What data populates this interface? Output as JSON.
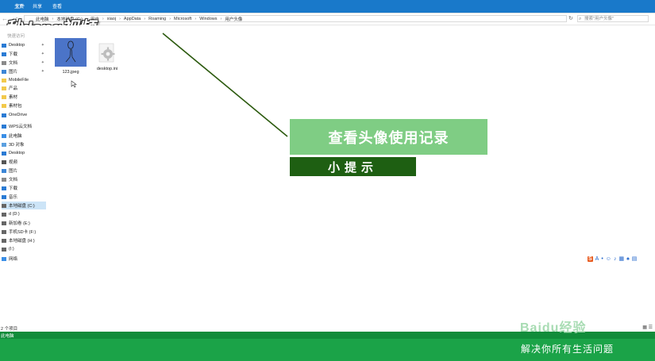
{
  "ribbon": {
    "file_tab": "文件",
    "tabs": [
      "主页",
      "共享",
      "查看"
    ]
  },
  "nav": {
    "back": "←",
    "forward": "→",
    "up": "↑"
  },
  "address": {
    "crumbs": [
      "此电脑",
      "本地磁盘 (C:)",
      "用户",
      "xiaoj",
      "AppData",
      "Roaming",
      "Microsoft",
      "Windows",
      "用户头像"
    ],
    "separator": "›"
  },
  "search": {
    "placeholder": "搜索\"用户头像\""
  },
  "watermark": {
    "logo_text": "秒dong视频"
  },
  "sidebar": {
    "quick_access": "快速访问",
    "items": [
      {
        "label": "Desktop",
        "icon": "desktop-icon",
        "pinned": true
      },
      {
        "label": "下载",
        "icon": "download-icon",
        "pinned": true
      },
      {
        "label": "文档",
        "icon": "document-icon",
        "pinned": true
      },
      {
        "label": "图片",
        "icon": "picture-icon",
        "pinned": true
      },
      {
        "label": "MobileFile",
        "icon": "folder-icon",
        "pinned": false
      },
      {
        "label": "产品",
        "icon": "folder-icon",
        "pinned": false
      },
      {
        "label": "素材",
        "icon": "folder-icon",
        "pinned": false
      },
      {
        "label": "素材包",
        "icon": "folder-icon",
        "pinned": false
      },
      {
        "label": "OneDrive",
        "icon": "cloud-icon",
        "pinned": false
      },
      {
        "label": "WPS云文档",
        "icon": "cloud-icon",
        "pinned": false
      },
      {
        "label": "此电脑",
        "icon": "computer-icon",
        "pinned": false
      },
      {
        "label": "3D 对象",
        "icon": "cube-icon",
        "pinned": false
      },
      {
        "label": "Desktop",
        "icon": "desktop-icon",
        "pinned": false
      },
      {
        "label": "视频",
        "icon": "video-icon",
        "pinned": false
      },
      {
        "label": "图片",
        "icon": "picture-icon",
        "pinned": false
      },
      {
        "label": "文档",
        "icon": "document-icon",
        "pinned": false
      },
      {
        "label": "下载",
        "icon": "download-icon",
        "pinned": false
      },
      {
        "label": "音乐",
        "icon": "music-icon",
        "pinned": false
      },
      {
        "label": "本地磁盘 (C:)",
        "icon": "drive-icon",
        "pinned": false,
        "selected": true
      },
      {
        "label": "d (D:)",
        "icon": "drive-icon",
        "pinned": false
      },
      {
        "label": "新加卷 (E:)",
        "icon": "drive-icon",
        "pinned": false
      },
      {
        "label": "手机SD卡 (F:)",
        "icon": "drive-icon",
        "pinned": false
      },
      {
        "label": "本地磁盘 (H:)",
        "icon": "drive-icon",
        "pinned": false
      },
      {
        "label": "(I:)",
        "icon": "drive-icon",
        "pinned": false
      },
      {
        "label": "网络",
        "icon": "network-icon",
        "pinned": false
      }
    ]
  },
  "files": [
    {
      "name": "123.jpeg",
      "type": "image"
    },
    {
      "name": "desktop.ini",
      "type": "settings"
    }
  ],
  "overlay": {
    "title": "查看头像使用记录",
    "tip": "小提示"
  },
  "status": {
    "count": "2 个项目"
  },
  "taskbar": {
    "label": "此电脑"
  },
  "footer": {
    "brand": "Baidu经验",
    "slogan": "解决你所有生活问题"
  },
  "ime": {
    "logo": "S",
    "lang": "A",
    "icons": [
      "dot",
      "smile",
      "mic",
      "keyboard",
      "shirt",
      "grid"
    ]
  },
  "colors": {
    "ribbon": "#1979ca",
    "banner_light": "#7fcd84",
    "banner_dark": "#1e5f12",
    "footer_green": "#1ba348"
  }
}
